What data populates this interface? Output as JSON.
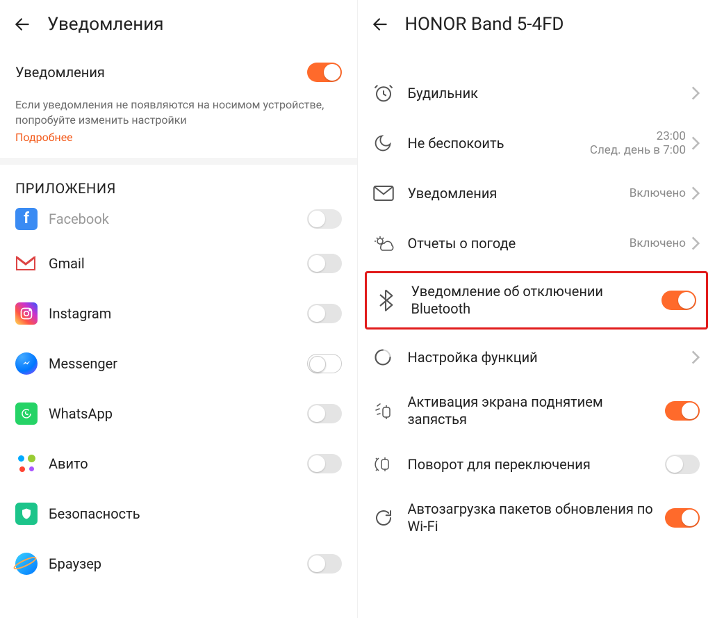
{
  "left": {
    "title": "Уведомления",
    "master": {
      "label": "Уведомления",
      "on": true
    },
    "helper_text": "Если уведомления не появляются на носимом устройстве, попробуйте изменить настройки",
    "helper_link": "Подробнее",
    "apps_header": "ПРИЛОЖЕНИЯ",
    "apps": [
      {
        "name": "Facebook",
        "icon": "facebook",
        "on": false
      },
      {
        "name": "Gmail",
        "icon": "gmail",
        "on": false
      },
      {
        "name": "Instagram",
        "icon": "instagram",
        "on": false
      },
      {
        "name": "Messenger",
        "icon": "messenger",
        "on": false
      },
      {
        "name": "WhatsApp",
        "icon": "whatsapp",
        "on": false
      },
      {
        "name": "Авито",
        "icon": "avito",
        "on": false
      },
      {
        "name": "Безопасность",
        "icon": "shield",
        "on": false
      },
      {
        "name": "Браузер",
        "icon": "browser",
        "on": false
      }
    ]
  },
  "right": {
    "title": "HONOR Band 5-4FD",
    "items": [
      {
        "icon": "alarm",
        "label": "Будильник",
        "trail": "",
        "type": "nav"
      },
      {
        "icon": "moon",
        "label": "Не беспокоить",
        "trail": "23:00",
        "trail2": "След. день в 7:00",
        "type": "nav"
      },
      {
        "icon": "mail",
        "label": "Уведомления",
        "trail": "Включено",
        "type": "nav"
      },
      {
        "icon": "weather",
        "label": "Отчеты о погоде",
        "trail": "Включено",
        "type": "nav"
      },
      {
        "icon": "bluetooth",
        "label": "Уведомление об отключении Bluetooth",
        "on": true,
        "type": "toggle",
        "highlight": true
      },
      {
        "icon": "loading",
        "label": "Настройка функций",
        "trail": "",
        "type": "nav"
      },
      {
        "icon": "wrist",
        "label": "Активация экрана поднятием запястья",
        "on": true,
        "type": "toggle"
      },
      {
        "icon": "rotate",
        "label": "Поворот для переключения",
        "on": false,
        "type": "toggle"
      },
      {
        "icon": "sync",
        "label": "Автозагрузка пакетов обновления по Wi-Fi",
        "on": true,
        "type": "toggle"
      }
    ]
  }
}
